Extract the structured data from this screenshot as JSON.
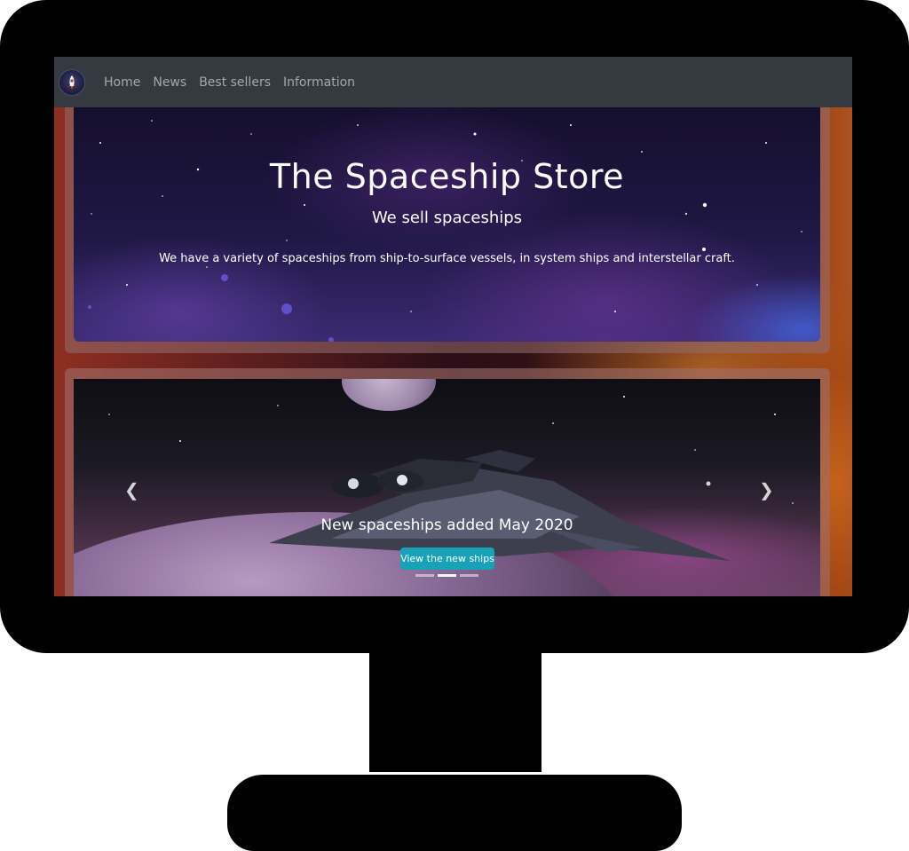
{
  "nav": {
    "brand_icon": "rocket-icon",
    "links": [
      "Home",
      "News",
      "Best sellers",
      "Information"
    ]
  },
  "hero": {
    "title": "The Spaceship Store",
    "subtitle": "We sell spaceships",
    "text": "We have a variety of spaceships from ship-to-surface vessels, in system ships and interstellar craft."
  },
  "carousel": {
    "caption": "New spaceships added May 2020",
    "button_label": "View the new ships",
    "prev_icon": "chevron-left-icon",
    "next_icon": "chevron-right-icon",
    "slide_count": 3,
    "active_slide": 2
  },
  "colors": {
    "navbar": "#343a40",
    "nav_link": "#a4a8ad",
    "button": "#17a2b8"
  }
}
